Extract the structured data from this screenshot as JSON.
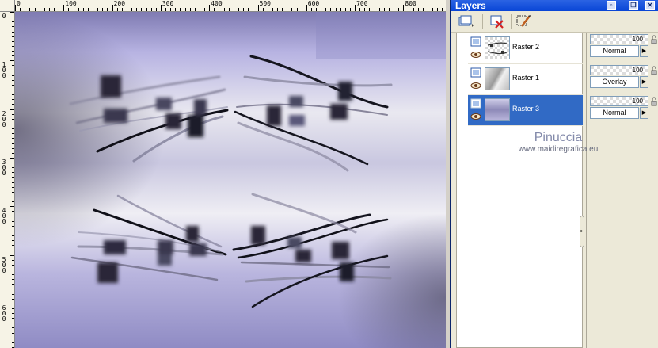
{
  "ruler": {
    "h_labels": [
      "0",
      "100",
      "200",
      "300",
      "400",
      "500",
      "600",
      "700",
      "800"
    ],
    "v_labels": [
      "0",
      "1\n0\n0",
      "2\n0\n0",
      "3\n0\n0",
      "4\n0\n0",
      "5\n0\n0",
      "6\n0\n0"
    ]
  },
  "palette": {
    "title": "Layers",
    "title_buttons": [
      "pin-icon",
      "restore-icon",
      "close-icon"
    ]
  },
  "layers": [
    {
      "name": "Raster 2",
      "opacity": "100",
      "blend": "Normal",
      "selected": false
    },
    {
      "name": "Raster 1",
      "opacity": "100",
      "blend": "Overlay",
      "selected": false
    },
    {
      "name": "Raster 3",
      "opacity": "100",
      "blend": "Normal",
      "selected": true
    }
  ],
  "watermark": {
    "line1": "Pinuccia",
    "line2": "www.maidiregrafica.eu"
  },
  "colors": {
    "selection": "#316ac5",
    "titlebar": "#0845d6",
    "canvas_tint": "#a9a4d6"
  }
}
